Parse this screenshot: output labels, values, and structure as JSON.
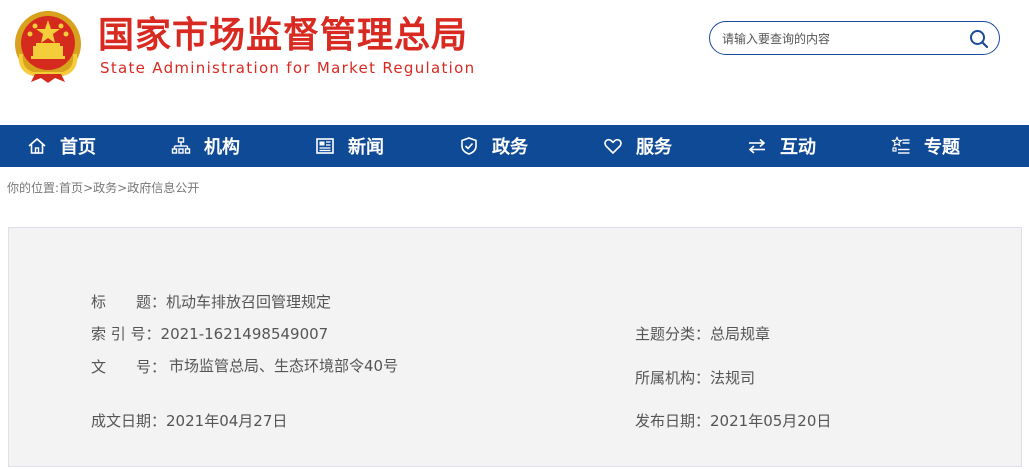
{
  "header": {
    "title_cn": "国家市场监督管理总局",
    "title_en": "State Administration for Market Regulation",
    "search_placeholder": "请输入要查询的内容"
  },
  "nav": {
    "items": [
      {
        "label": "首页",
        "icon": "home-icon"
      },
      {
        "label": "机构",
        "icon": "org-icon"
      },
      {
        "label": "新闻",
        "icon": "news-icon"
      },
      {
        "label": "政务",
        "icon": "shield-icon"
      },
      {
        "label": "服务",
        "icon": "heart-icon"
      },
      {
        "label": "互动",
        "icon": "exchange-icon"
      },
      {
        "label": "专题",
        "icon": "topic-icon"
      }
    ]
  },
  "breadcrumb": {
    "prefix": "你的位置:",
    "items": [
      "首页",
      "政务",
      "政府信息公开"
    ],
    "separator": ">"
  },
  "document": {
    "title_label": "标　　题：",
    "title_value": "机动车排放召回管理规定",
    "index_label": "索 引 号：",
    "index_value": "2021-1621498549007",
    "category_label": "主题分类：",
    "category_value": "总局规章",
    "docno_label": "文　　号：",
    "docno_value": "市场监管总局、生态环境部令40号",
    "org_label": "所属机构：",
    "org_value": "法规司",
    "date_label": "成文日期：",
    "date_value": "2021年04月27日",
    "publish_label": "发布日期：",
    "publish_value": "2021年05月20日"
  },
  "colors": {
    "brand_red": "#d92a22",
    "nav_blue": "#0f4a96",
    "panel_bg": "#f3f3f3"
  }
}
